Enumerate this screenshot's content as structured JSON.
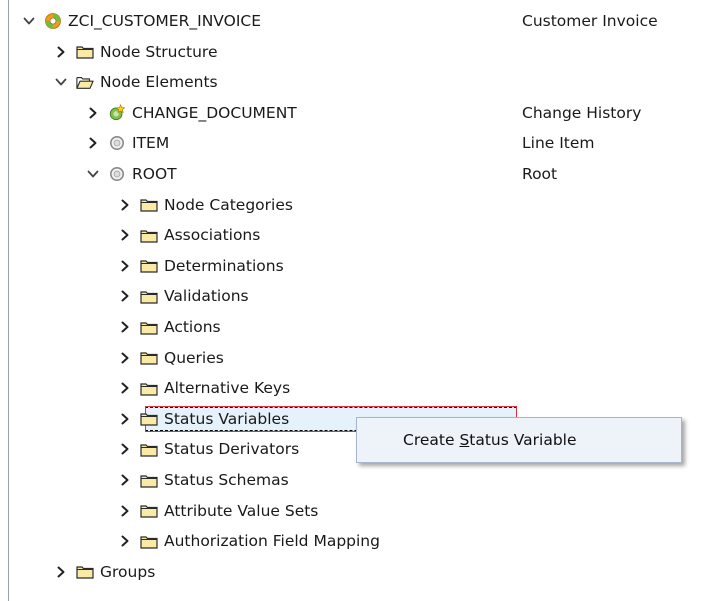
{
  "tree": {
    "rows": [
      {
        "label": "ZCI_CUSTOMER_INVOICE",
        "description": "Customer Invoice",
        "icon": "bo-root-icon",
        "expander": "expanded",
        "level": 0
      },
      {
        "label": "Node Structure",
        "description": "",
        "icon": "folder-icon",
        "expander": "collapsed",
        "level": 1
      },
      {
        "label": "Node Elements",
        "description": "",
        "icon": "folder-open-icon",
        "expander": "expanded",
        "level": 1
      },
      {
        "label": "CHANGE_DOCUMENT",
        "description": "Change History",
        "icon": "change-document-icon",
        "expander": "collapsed",
        "level": 2
      },
      {
        "label": "ITEM",
        "description": "Line Item",
        "icon": "node-circle-icon",
        "expander": "collapsed",
        "level": 2
      },
      {
        "label": "ROOT",
        "description": "Root",
        "icon": "node-circle-icon",
        "expander": "expanded",
        "level": 2
      },
      {
        "label": "Node Categories",
        "description": "",
        "icon": "folder-icon",
        "expander": "collapsed",
        "level": 3
      },
      {
        "label": "Associations",
        "description": "",
        "icon": "folder-icon",
        "expander": "collapsed",
        "level": 3
      },
      {
        "label": "Determinations",
        "description": "",
        "icon": "folder-icon",
        "expander": "collapsed",
        "level": 3
      },
      {
        "label": "Validations",
        "description": "",
        "icon": "folder-icon",
        "expander": "collapsed",
        "level": 3
      },
      {
        "label": "Actions",
        "description": "",
        "icon": "folder-icon",
        "expander": "collapsed",
        "level": 3
      },
      {
        "label": "Queries",
        "description": "",
        "icon": "folder-icon",
        "expander": "collapsed",
        "level": 3
      },
      {
        "label": "Alternative Keys",
        "description": "",
        "icon": "folder-icon",
        "expander": "collapsed",
        "level": 3
      },
      {
        "label": "Status Variables",
        "description": "",
        "icon": "folder-icon",
        "expander": "collapsed",
        "level": 3,
        "selected": true
      },
      {
        "label": "Status Derivators",
        "description": "",
        "icon": "folder-icon",
        "expander": "collapsed",
        "level": 3
      },
      {
        "label": "Status Schemas",
        "description": "",
        "icon": "folder-icon",
        "expander": "collapsed",
        "level": 3
      },
      {
        "label": "Attribute Value Sets",
        "description": "",
        "icon": "folder-icon",
        "expander": "collapsed",
        "level": 3
      },
      {
        "label": "Authorization Field Mapping",
        "description": "",
        "icon": "folder-icon",
        "expander": "collapsed",
        "level": 3
      },
      {
        "label": "Groups",
        "description": "",
        "icon": "folder-icon",
        "expander": "collapsed",
        "level": 1
      }
    ]
  },
  "context_menu": {
    "item_before": "Create ",
    "item_mnemonic": "S",
    "item_after": "tatus Variable"
  },
  "colors": {
    "folder_fill": "#fbe9a6",
    "folder_stroke": "#2b2b2b",
    "selection_fill": "#e5f1fb",
    "red_outline": "#e0303c",
    "menu_bg": "#eef3fa"
  }
}
